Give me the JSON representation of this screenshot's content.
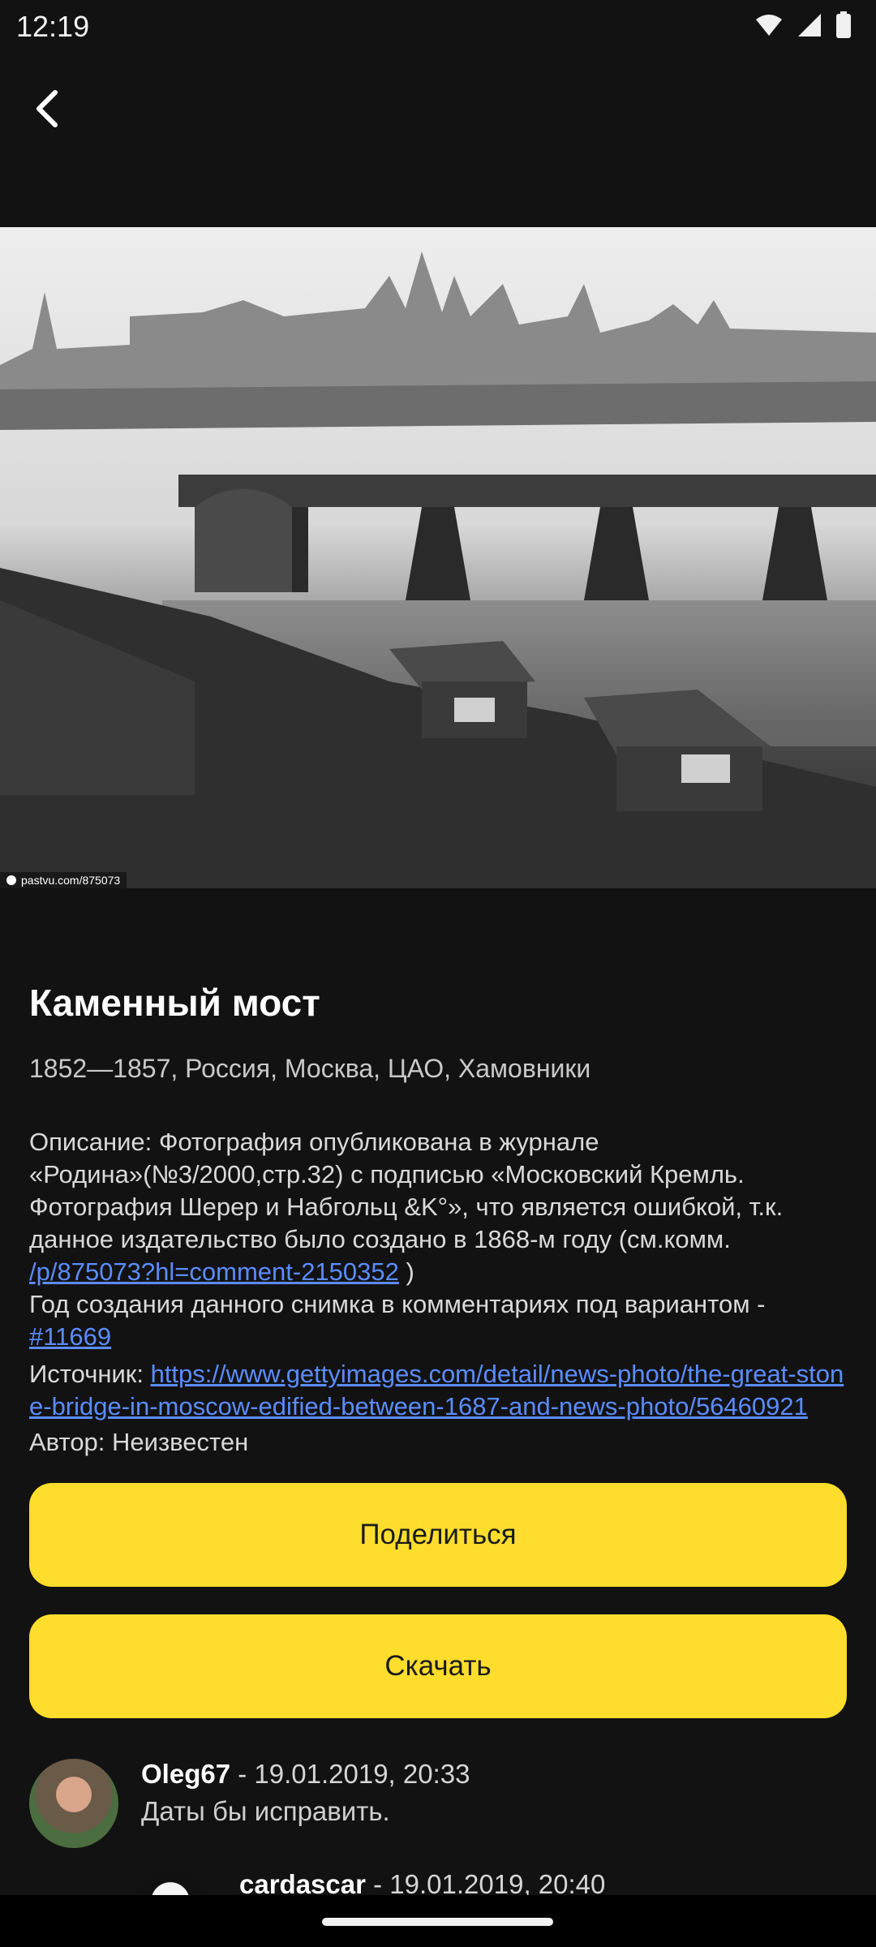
{
  "status_bar": {
    "time": "12:19",
    "icons": [
      "wifi-icon",
      "signal-icon",
      "battery-icon"
    ]
  },
  "app_bar": {
    "back_icon": "chevron-left-icon"
  },
  "photo": {
    "watermark": "pastvu.com/875073"
  },
  "details": {
    "title": "Каменный мост",
    "subtitle": "1852—1857, Россия, Москва, ЦАО, Хамовники",
    "description_prefix": "Описание: Фотография опубликована в журнале «Родина»(№3/2000,стр.32) с подписью «Московский Кремль. Фотография Шерер и Набгольц &K°», что является ошибкой, т.к. данное издательство было создано в 1868-м году (см.комм. ",
    "description_link1": "/p/875073?hl=comment-2150352",
    "description_mid": " )\nГод создания данного снимка в комментариях под вариантом - ",
    "description_link2": "#11669",
    "source_label": "Источник: ",
    "source_link": "https://www.gettyimages.com/detail/news-photo/the-great-stone-bridge-in-moscow-edified-between-1687-and-news-photo/56460921",
    "author": "Автор: Неизвестен"
  },
  "buttons": {
    "share": "Поделиться",
    "download": "Скачать"
  },
  "comments": [
    {
      "user": "Oleg67",
      "date": " - 19.01.2019, 20:33",
      "text": "Даты бы исправить."
    },
    {
      "user": "cardascar",
      "date": " - 19.01.2019, 20:40",
      "text": ""
    }
  ],
  "colors": {
    "accent": "#ffdd2d",
    "link": "#5b8cff",
    "background": "#121212"
  }
}
